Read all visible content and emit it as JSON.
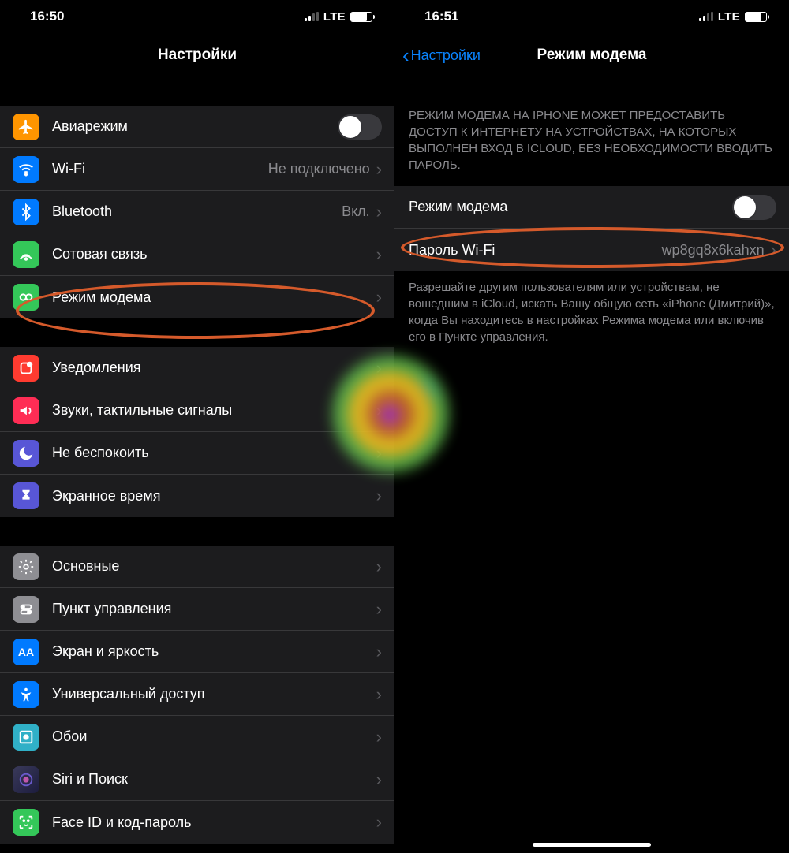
{
  "left": {
    "status_time": "16:50",
    "network_label": "LTE",
    "page_title": "Настройки",
    "group1": [
      {
        "id": "airplane",
        "label": "Авиарежим",
        "toggle": false,
        "iconBg": "#ff9500"
      },
      {
        "id": "wifi",
        "label": "Wi-Fi",
        "value": "Не подключено",
        "iconBg": "#007aff"
      },
      {
        "id": "bluetooth",
        "label": "Bluetooth",
        "value": "Вкл.",
        "iconBg": "#007aff"
      },
      {
        "id": "cellular",
        "label": "Сотовая связь",
        "iconBg": "#34c759"
      },
      {
        "id": "hotspot",
        "label": "Режим модема",
        "iconBg": "#34c759"
      }
    ],
    "group2": [
      {
        "id": "notifications",
        "label": "Уведомления",
        "iconBg": "#ff3b30"
      },
      {
        "id": "sounds",
        "label": "Звуки, тактильные сигналы",
        "iconBg": "#ff2d55"
      },
      {
        "id": "dnd",
        "label": "Не беспокоить",
        "iconBg": "#5856d6"
      },
      {
        "id": "screentime",
        "label": "Экранное время",
        "iconBg": "#5856d6"
      }
    ],
    "group3": [
      {
        "id": "general",
        "label": "Основные",
        "iconBg": "#8e8e93"
      },
      {
        "id": "controlcenter",
        "label": "Пункт управления",
        "iconBg": "#8e8e93"
      },
      {
        "id": "display",
        "label": "Экран и яркость",
        "iconBg": "#007aff"
      },
      {
        "id": "accessibility",
        "label": "Универсальный доступ",
        "iconBg": "#007aff"
      },
      {
        "id": "wallpaper",
        "label": "Обои",
        "iconBg": "#36c2c2"
      },
      {
        "id": "siri",
        "label": "Siri и Поиск",
        "iconBg": "#1c1c1e"
      },
      {
        "id": "faceid",
        "label": "Face ID и код-пароль",
        "iconBg": "#34c759"
      }
    ]
  },
  "right": {
    "status_time": "16:51",
    "network_label": "LTE",
    "back_label": "Настройки",
    "page_title": "Режим модема",
    "intro": "РЕЖИМ МОДЕМА НА IPHONE МОЖЕТ ПРЕДОСТАВИТЬ ДОСТУП К ИНТЕРНЕТУ НА УСТРОЙСТВАХ, НА КОТОРЫХ ВЫПОЛНЕН ВХОД В ICLOUD, БЕЗ НЕОБХОДИМОСТИ ВВОДИТЬ ПАРОЛЬ.",
    "rows": {
      "hotspot_toggle_label": "Режим модема",
      "password_label": "Пароль Wi-Fi",
      "password_value": "wp8gq8x6kahxn"
    },
    "outro": "Разрешайте другим пользователям или устройствам, не вошедшим в iCloud, искать Вашу общую сеть «iPhone (Дмитрий)», когда Вы находитесь в настройках Режима модема или включив его в Пункте управления."
  }
}
